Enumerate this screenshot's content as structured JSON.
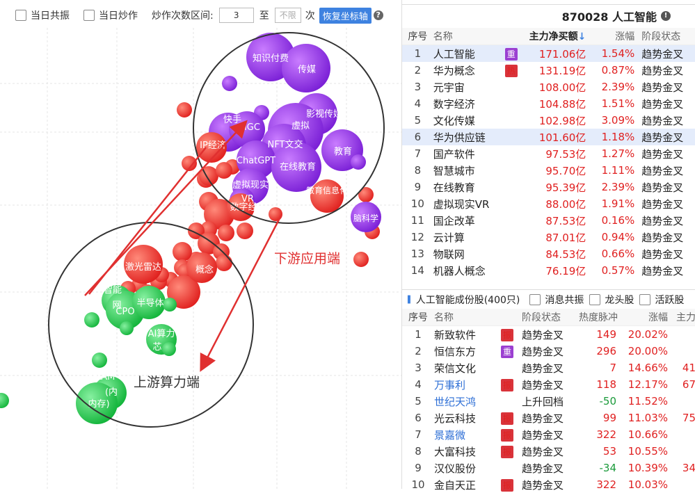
{
  "toolbar": {
    "cb1_label": "当日共振",
    "cb2_label": "当日炒作",
    "range_label": "炒作次数区间:",
    "range_from": "3",
    "range_to_label": "至",
    "range_to_placeholder": "不限",
    "unit_label": "次",
    "reset_label": "恢复坐标轴",
    "help_icon": "?"
  },
  "chart": {
    "annotation_downstream": "下游应用端",
    "annotation_upstream": "上游算力端",
    "colors": {
      "purple": "#8a2be2",
      "red": "#e82a2a",
      "green": "#1fbf4a",
      "annotation": "#e03030"
    },
    "bubble_labels": {
      "zhishi": "知识付费",
      "chuanmei": "传媒",
      "yingshi": "影视传媒",
      "kuai": "快手",
      "aigc": "AIGC",
      "xuni": "虚拟",
      "ip": "IP经济",
      "nft": "NFT文交",
      "jiaoyu": "教育",
      "chatgpt": "ChatGPT",
      "zaixian": "在线教育",
      "jiaoyuxin": "教育信息化",
      "naokexue": "脑科学",
      "xuxianshi": "虚拟现实",
      "vr": "VR",
      "shuzijing": "数字经",
      "jiguang": "激光雷达",
      "gainian": "概念",
      "zhineng": "智能",
      "wang": "网",
      "cpo": "CPO",
      "bandaoti": "半导体",
      "aisuanli": "AI算力",
      "xin": "芯",
      "dram": "DRAM",
      "nei": "(内",
      "cun": "内存)"
    }
  },
  "right_panel": {
    "stock_title": "870028 人工智能",
    "info_icon": "!",
    "headers": {
      "idx": "序号",
      "name": "名称",
      "value": "主力净买额",
      "sort_arrow": "↓",
      "pct": "涨幅",
      "stage": "阶段状态"
    },
    "rows": [
      {
        "idx": "1",
        "name": "人工智能",
        "tag": "重",
        "tag_color": "purple",
        "value": "171.06亿",
        "pct": "1.54%",
        "stage": "趋势金叉"
      },
      {
        "idx": "2",
        "name": "华为概念",
        "tag": "热",
        "tag_color": "red",
        "value": "131.19亿",
        "pct": "0.87%",
        "stage": "趋势金叉"
      },
      {
        "idx": "3",
        "name": "元宇宙",
        "tag": "",
        "tag_color": "",
        "value": "108.00亿",
        "pct": "2.39%",
        "stage": "趋势金叉"
      },
      {
        "idx": "4",
        "name": "数字经济",
        "tag": "",
        "tag_color": "",
        "value": "104.88亿",
        "pct": "1.51%",
        "stage": "趋势金叉"
      },
      {
        "idx": "5",
        "name": "文化传媒",
        "tag": "",
        "tag_color": "",
        "value": "102.98亿",
        "pct": "3.09%",
        "stage": "趋势金叉"
      },
      {
        "idx": "6",
        "name": "华为供应链",
        "tag": "",
        "tag_color": "",
        "value": "101.60亿",
        "pct": "1.18%",
        "stage": "趋势金叉"
      },
      {
        "idx": "7",
        "name": "国产软件",
        "tag": "",
        "tag_color": "",
        "value": "97.53亿",
        "pct": "1.27%",
        "stage": "趋势金叉"
      },
      {
        "idx": "8",
        "name": "智慧城市",
        "tag": "",
        "tag_color": "",
        "value": "95.70亿",
        "pct": "1.11%",
        "stage": "趋势金叉"
      },
      {
        "idx": "9",
        "name": "在线教育",
        "tag": "",
        "tag_color": "",
        "value": "95.39亿",
        "pct": "2.39%",
        "stage": "趋势金叉"
      },
      {
        "idx": "10",
        "name": "虚拟现实VR",
        "tag": "",
        "tag_color": "",
        "value": "88.00亿",
        "pct": "1.91%",
        "stage": "趋势金叉"
      },
      {
        "idx": "11",
        "name": "国企改革",
        "tag": "",
        "tag_color": "",
        "value": "87.53亿",
        "pct": "0.16%",
        "stage": "趋势金叉"
      },
      {
        "idx": "12",
        "name": "云计算",
        "tag": "",
        "tag_color": "",
        "value": "87.01亿",
        "pct": "0.94%",
        "stage": "趋势金叉"
      },
      {
        "idx": "13",
        "name": "物联网",
        "tag": "",
        "tag_color": "",
        "value": "84.53亿",
        "pct": "0.66%",
        "stage": "趋势金叉"
      },
      {
        "idx": "14",
        "name": "机器人概念",
        "tag": "",
        "tag_color": "",
        "value": "76.19亿",
        "pct": "0.57%",
        "stage": "趋势金叉"
      }
    ],
    "sub_section": {
      "title": "人工智能成份股(400只)",
      "cb_labels": [
        "消息共振",
        "龙头股",
        "活跃股"
      ],
      "headers": {
        "idx": "序号",
        "name": "名称",
        "stage": "阶段状态",
        "heat": "热度脉冲",
        "pct": "涨幅",
        "extra": "主力"
      },
      "rows": [
        {
          "idx": "1",
          "name": "新致软件",
          "name_color": "dark",
          "tag": "振",
          "tag_color": "red",
          "stage": "趋势金叉",
          "heat": "149",
          "heat_color": "red",
          "pct": "20.02%",
          "extra": ""
        },
        {
          "idx": "2",
          "name": "恒信东方",
          "name_color": "dark",
          "tag": "重",
          "tag_color": "purple",
          "stage": "趋势金叉",
          "heat": "296",
          "heat_color": "red",
          "pct": "20.00%",
          "extra": ""
        },
        {
          "idx": "3",
          "name": "荣信文化",
          "name_color": "dark",
          "tag": "",
          "tag_color": "",
          "stage": "趋势金叉",
          "heat": "7",
          "heat_color": "red",
          "pct": "14.66%",
          "extra": "41"
        },
        {
          "idx": "4",
          "name": "万事利",
          "name_color": "blue",
          "tag": "振",
          "tag_color": "red",
          "stage": "趋势金叉",
          "heat": "118",
          "heat_color": "red",
          "pct": "12.17%",
          "extra": "67"
        },
        {
          "idx": "5",
          "name": "世纪天鸿",
          "name_color": "blue",
          "tag": "",
          "tag_color": "",
          "stage": "上升回档",
          "heat": "-50",
          "heat_color": "green",
          "pct": "11.52%",
          "extra": ""
        },
        {
          "idx": "6",
          "name": "光云科技",
          "name_color": "dark",
          "tag": "振",
          "tag_color": "red",
          "stage": "趋势金叉",
          "heat": "99",
          "heat_color": "red",
          "pct": "11.03%",
          "extra": "75"
        },
        {
          "idx": "7",
          "name": "景嘉微",
          "name_color": "blue",
          "tag": "振",
          "tag_color": "red",
          "stage": "趋势金叉",
          "heat": "322",
          "heat_color": "red",
          "pct": "10.66%",
          "extra": ""
        },
        {
          "idx": "8",
          "name": "大富科技",
          "name_color": "dark",
          "tag": "振",
          "tag_color": "red",
          "stage": "趋势金叉",
          "heat": "53",
          "heat_color": "red",
          "pct": "10.55%",
          "extra": ""
        },
        {
          "idx": "9",
          "name": "汉仪股份",
          "name_color": "dark",
          "tag": "",
          "tag_color": "",
          "stage": "趋势金叉",
          "heat": "-34",
          "heat_color": "green",
          "pct": "10.39%",
          "extra": "34"
        },
        {
          "idx": "10",
          "name": "金自天正",
          "name_color": "dark",
          "tag": "振",
          "tag_color": "red",
          "stage": "趋势金叉",
          "heat": "322",
          "heat_color": "red",
          "pct": "10.03%",
          "extra": ""
        }
      ]
    }
  }
}
